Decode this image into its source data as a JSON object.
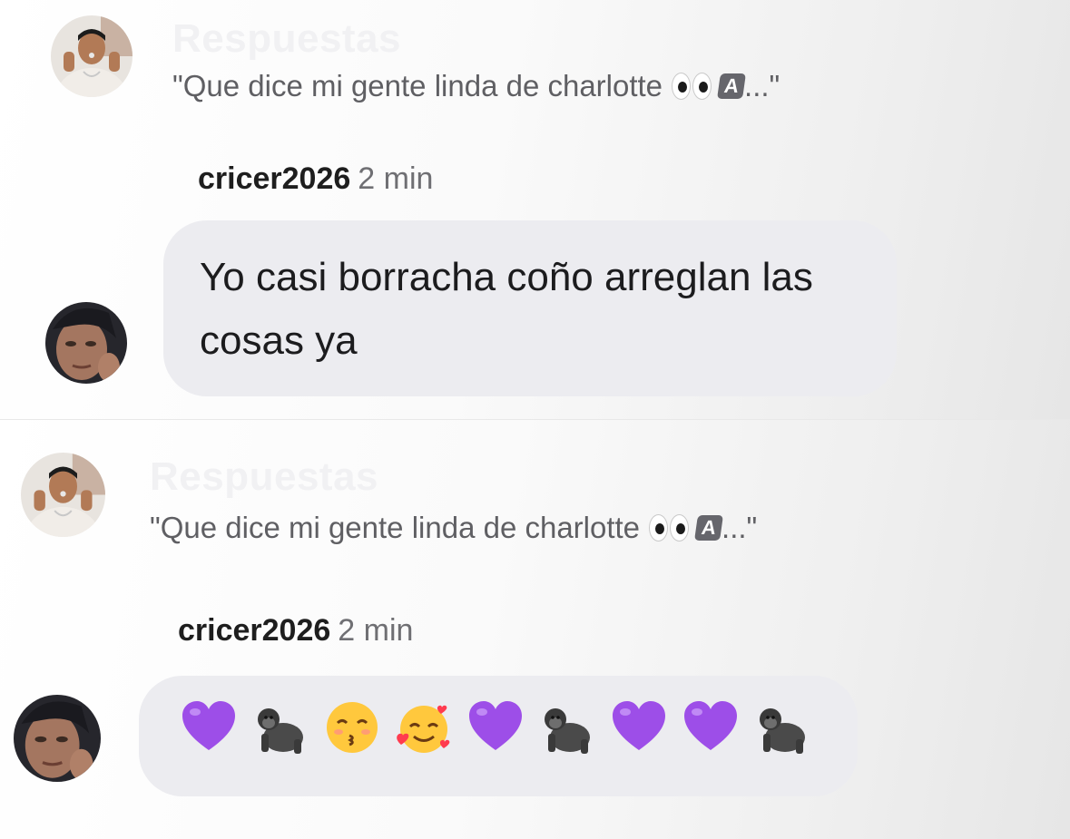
{
  "replies": [
    {
      "header": "Respuestas",
      "quote": "\"Que dice mi gente linda de charlotte",
      "quote_suffix": "...\"",
      "quote_emoji": [
        "eyes-emoji",
        "keycap-a-emoji"
      ],
      "username": "cricer2026",
      "time": "2 min",
      "message": "Yo casi borracha coño arreglan las cosas ya"
    },
    {
      "header": "Respuestas",
      "quote": "\"Que dice mi gente linda de charlotte",
      "quote_suffix": "...\"",
      "quote_emoji": [
        "eyes-emoji",
        "keycap-a-emoji"
      ],
      "username": "cricer2026",
      "time": "2 min",
      "message_emoji": [
        "purple-heart",
        "gorilla",
        "kissing-face",
        "smiling-face-with-hearts",
        "purple-heart",
        "gorilla",
        "purple-heart",
        "purple-heart",
        "gorilla"
      ]
    }
  ],
  "colors": {
    "bubble": "#ececf0",
    "quote_text": "#5f5f63",
    "purple_heart": "#9d4ee8",
    "gorilla": "#4a4a4a",
    "face": "#ffc83d"
  }
}
